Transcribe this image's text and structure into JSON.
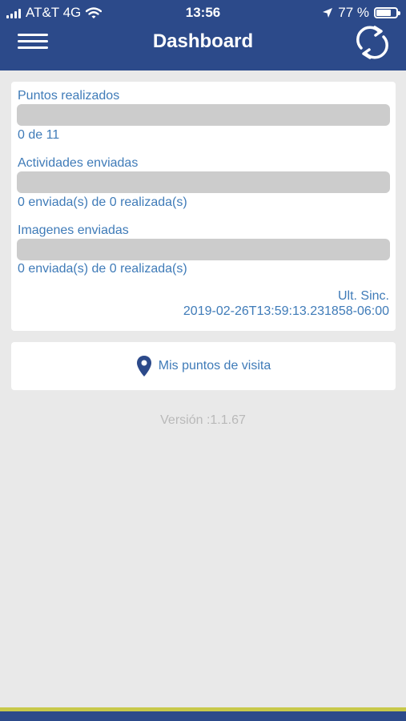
{
  "status_bar": {
    "carrier": "AT&T 4G",
    "time": "13:56",
    "battery": "77 %",
    "battery_level": 0.77
  },
  "header": {
    "title": "Dashboard",
    "menu_icon": "hamburger-menu-icon",
    "sync_icon": "sync-icon"
  },
  "stats": [
    {
      "label": "Puntos realizados",
      "value": "0 de 11",
      "progress": 0
    },
    {
      "label": "Actividades enviadas",
      "value": "0 enviada(s) de 0 realizada(s)",
      "progress": 0
    },
    {
      "label": "Imagenes enviadas",
      "value": "0 enviada(s) de 0 realizada(s)",
      "progress": 0
    }
  ],
  "sync": {
    "label": "Ult. Sinc.",
    "value": "2019-02-26T13:59:13.231858-06:00"
  },
  "visit_button": {
    "label": "Mis puntos de visita",
    "icon": "map-pin-icon"
  },
  "version": "Versión :1.1.67",
  "colors": {
    "header": "#2c4a8a",
    "accent_text": "#3f7bb8",
    "background": "#e9e9e9",
    "progress_track": "#cccccc",
    "footer_stripe": "#c8c94a"
  }
}
